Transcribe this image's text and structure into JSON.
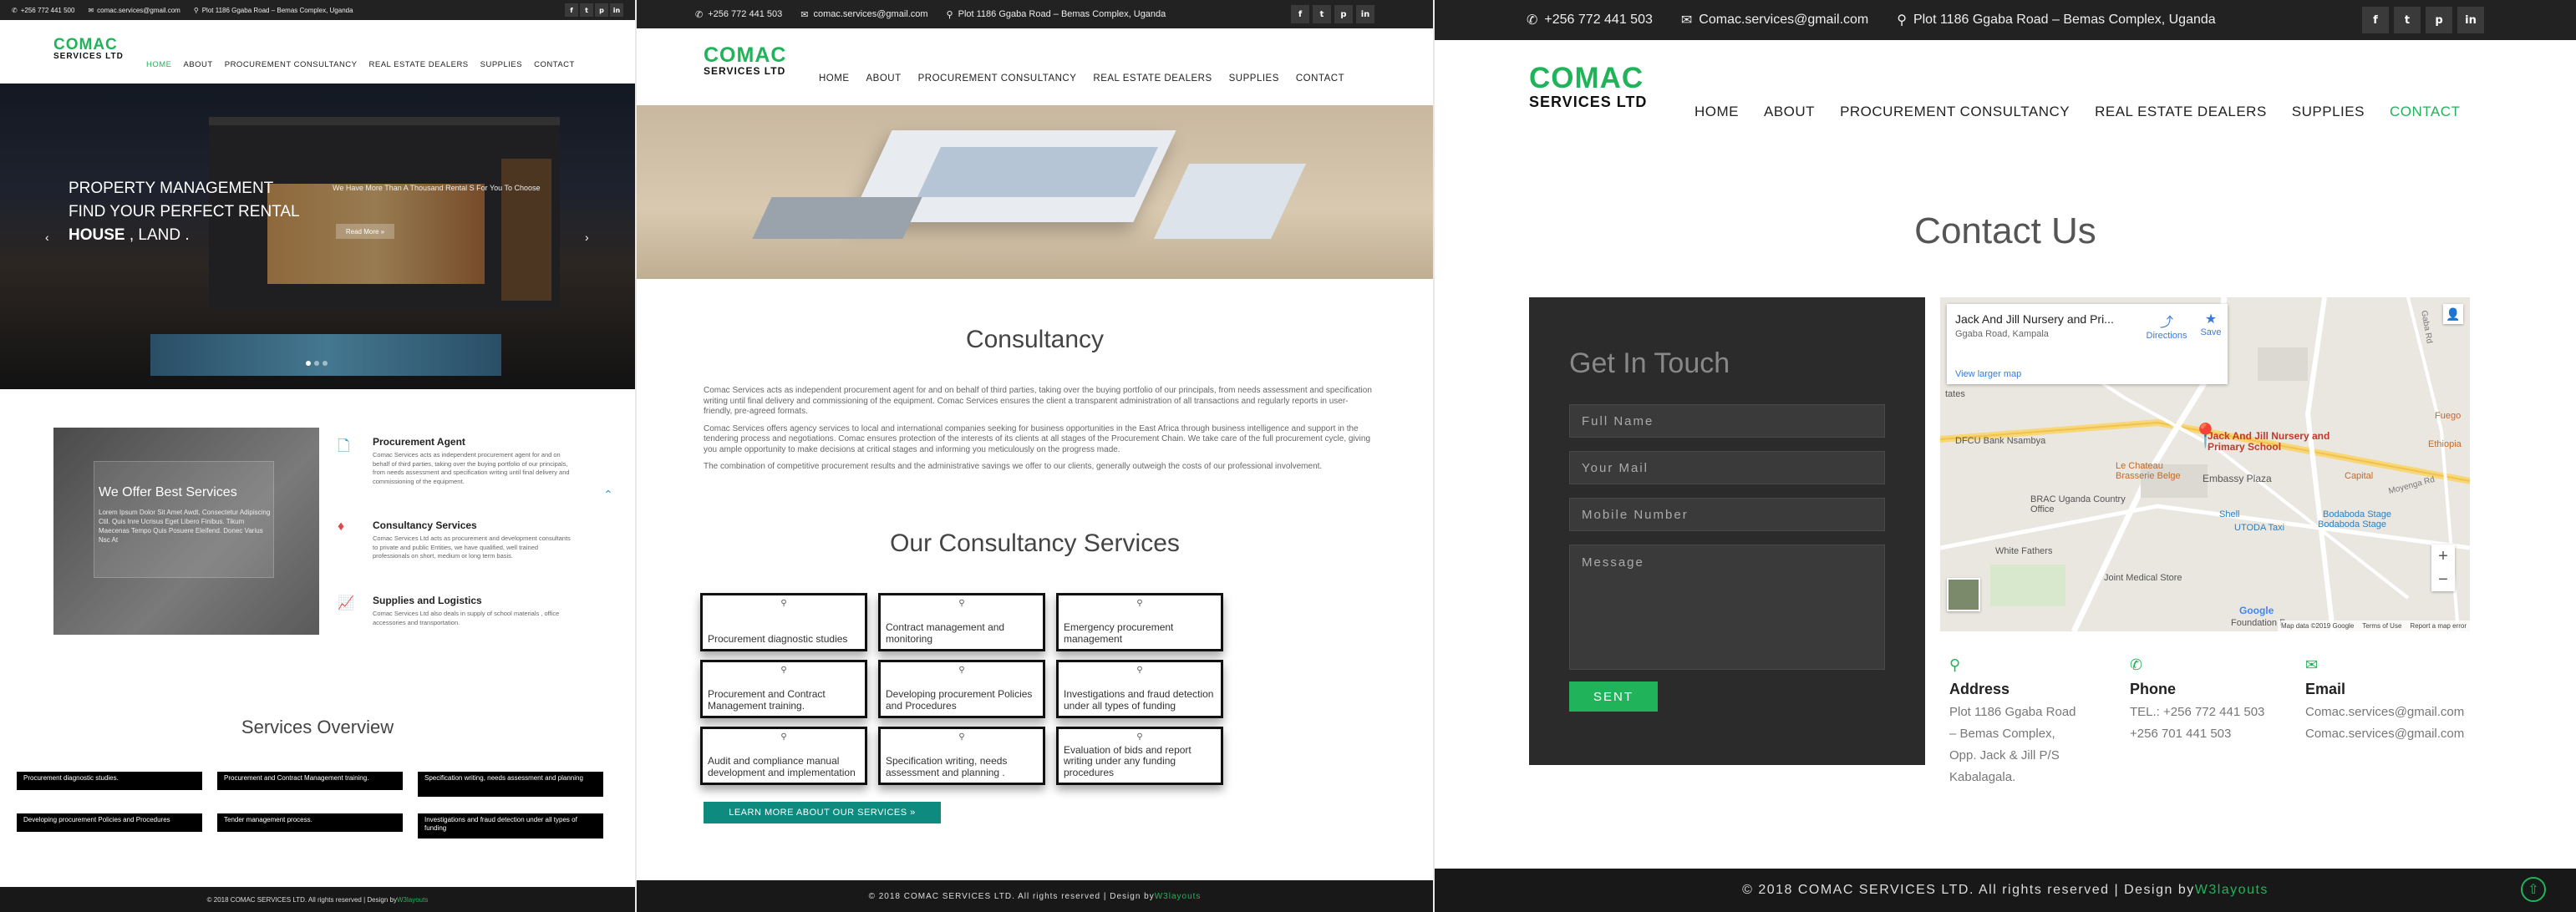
{
  "contact": {
    "phone": "+256 772 441 503",
    "phone_short": "+256 772 441 500",
    "email": "comac.services@gmail.com",
    "email_cap": "Comac.services@gmail.com",
    "address": "Plot 1186 Ggaba Road – Bemas Complex, Uganda"
  },
  "brand": {
    "line1": "COMAC",
    "line2": "SERVICES LTD",
    "accent": "#21b35a"
  },
  "nav": [
    "HOME",
    "ABOUT",
    "PROCUREMENT CONSULTANCY",
    "REAL ESTATE DEALERS",
    "SUPPLIES",
    "CONTACT"
  ],
  "social": [
    "f",
    "t",
    "p",
    "in"
  ],
  "home": {
    "hero": {
      "line1": "PROPERTY MANAGEMENT",
      "line2": "FIND YOUR PERFECT RENTAL",
      "line3a": "HOUSE",
      "line3b": " , LAND .",
      "right_text": "We Have More Than A Thousand Rental S For You To Choose",
      "read_more": "Read More »"
    },
    "offer": {
      "title": "We Offer Best Services",
      "text": "Lorem Ipsum Dolor Sit Amet Awdt, Consectetur Adipiscing Ctil. Quis Inre Ucrisus Eget Libero Finibus. Tikum Maecenas Tempo Quis Posuere Eleifend. Donec Varius Nsc At"
    },
    "features": [
      {
        "title": "Procurement Agent",
        "text": "Comac Services acts as independent procurement agent for and on behalf of third parties, taking over the buying portfolio of our principals, from needs assessment and specification writing until final delivery and commissioning of the equipment."
      },
      {
        "title": "Consultancy Services",
        "text": "Comac Services Ltd acts as procurement and development consultants to private and public Entities, we have qualified, well trained professionals on short, medium or long term basis."
      },
      {
        "title": "Supplies and Logistics",
        "text": "Comac Services Ltd also deals in supply of school materials , office accessories and transportation."
      }
    ],
    "overview_title": "Services Overview",
    "overview_items": [
      "Procurement diagnostic studies.",
      "Procurement and Contract Management training.",
      "Specification writing, needs assessment and planning",
      "Developing procurement Policies and Procedures",
      "Tender management process.",
      "Investigations and fraud detection under all types of funding"
    ],
    "footer_copy": "© 2018 COMAC SERVICES LTD. All rights reserved | Design by ",
    "footer_design": "W3layouts"
  },
  "consultancy": {
    "title": "Consultancy",
    "paragraphs": [
      "Comac Services acts as independent procurement agent for and on behalf of third parties, taking over the buying portfolio of our principals, from needs assessment and specification writing until final delivery and commissioning of the equipment. Comac Services ensures the client a transparent administration of all transactions and regularly reports in user-friendly, pre-agreed formats.",
      "Comac Services offers agency services to local and international companies seeking for business opportunities in the East Africa through business intelligence and support in the tendering process and negotiations. Comac ensures protection of the interests of its clients at all stages of the Procurement Chain. We take care of the full procurement cycle, giving you ample opportunity to make decisions at critical stages and informing you meticulously on the progress made.",
      "The combination of competitive procurement results and the administrative savings we offer to our clients, generally outweigh the costs of our professional involvement."
    ],
    "services_title": "Our Consultancy Services",
    "services": [
      "Procurement diagnostic studies",
      "Contract management and monitoring",
      "Emergency procurement management",
      "Procurement and Contract Management training.",
      "Developing procurement Policies and Procedures",
      "Investigations and fraud detection under all types of funding",
      "Audit and compliance manual development and implementation",
      "Specification writing, needs assessment and planning .",
      "Evaluation of bids and report writing under any funding procedures"
    ],
    "learn_more": "LEARN MORE ABOUT OUR SERVICES »",
    "footer_copy": "© 2018 COMAC SERVICES LTD. All rights reserved | Design by ",
    "footer_design": "W3layouts"
  },
  "contact_page": {
    "title": "Contact Us",
    "form_title": "Get In Touch",
    "placeholders": {
      "name": "Full Name",
      "mail": "Your Mail",
      "mobile": "Mobile Number",
      "message": "Message"
    },
    "submit": "SENT",
    "map": {
      "place": "Jack And Jill Nursery and Pri...",
      "place_addr": "Ggaba Road, Kampala",
      "directions": "Directions",
      "save": "Save",
      "larger": "View larger map",
      "labels": [
        "Jack And Jill Nursery and Primary School",
        "Le Chateau Brasserie Belge",
        "Embassy Plaza",
        "DFCU Bank Nsambya",
        "BRAC Uganda Country Office",
        "Shell",
        "UTODA Taxi",
        "Bodaboda Stage",
        "Bodaboda Stage",
        "White Fathers",
        "Joint Medical Store",
        "Capital",
        "Ethiopia",
        "Moyenga Rd",
        "Fuego",
        "Foundation F",
        "Google",
        "Map data ©2019 Google",
        "Terms of Use",
        "Report a map error",
        "tates",
        "Gaba Rd"
      ]
    },
    "address_title": "Address",
    "address_lines": [
      "Plot 1186 Ggaba Road",
      "– Bemas Complex,",
      "Opp. Jack & Jill P/S",
      "Kabalagala."
    ],
    "phone_title": "Phone",
    "phone_lines": [
      "TEL.: +256 772 441 503",
      "+256 701 441 503"
    ],
    "email_title": "Email",
    "email_lines": [
      "Comac.services@gmail.com",
      "Comac.services@gmail.com"
    ],
    "footer_copy": "© 2018 COMAC SERVICES LTD. All rights reserved | Design by ",
    "footer_design": "W3layouts"
  }
}
